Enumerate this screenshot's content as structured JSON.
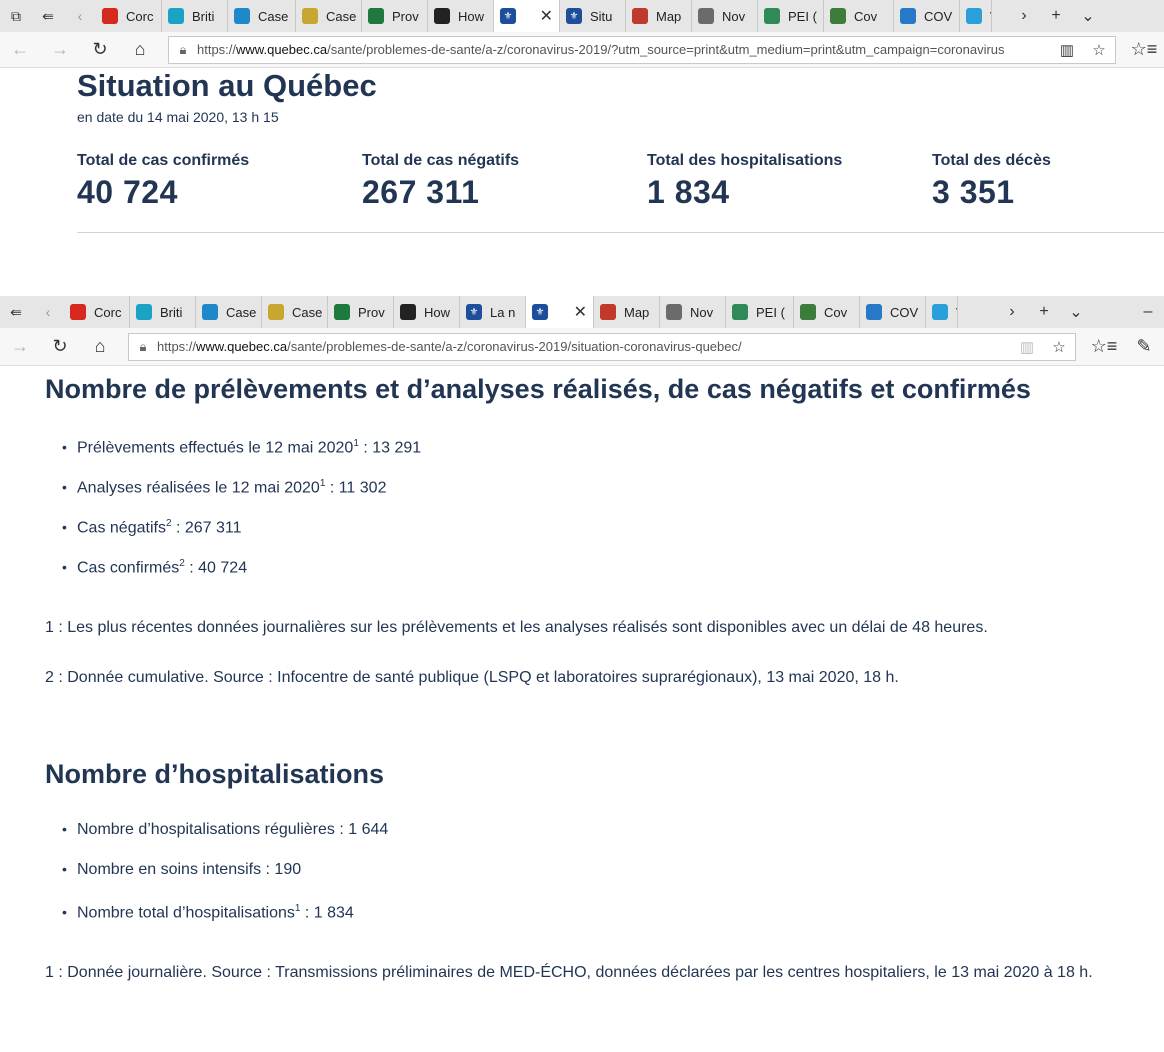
{
  "browser1": {
    "tabs": [
      {
        "label": "Corc",
        "color": "#d6281e",
        "icon": "maple-leaf-icon"
      },
      {
        "label": "Briti",
        "color": "#1ba3c6",
        "icon": "bc-icon"
      },
      {
        "label": "Case",
        "color": "#1e88c8",
        "icon": "alberta-icon"
      },
      {
        "label": "Case",
        "color": "#c8a630",
        "icon": "sask-icon"
      },
      {
        "label": "Prov",
        "color": "#1e7a3c",
        "icon": "manitoba-icon"
      },
      {
        "label": "How",
        "color": "#222222",
        "icon": "ontario-icon"
      },
      {
        "label": "",
        "color": "#1d4e9b",
        "icon": "quebec-fleur-icon",
        "active": true
      },
      {
        "label": "Situ",
        "color": "#1d4e9b",
        "icon": "quebec-fleur-icon"
      },
      {
        "label": "Map",
        "color": "#c0392b",
        "icon": "nb-icon"
      },
      {
        "label": "Nov",
        "color": "#6b6b6b",
        "icon": "ns-icon"
      },
      {
        "label": "PEI (",
        "color": "#2e8b57",
        "icon": "pei-icon"
      },
      {
        "label": "Cov",
        "color": "#3c7d3c",
        "icon": "nl-icon"
      },
      {
        "label": "COV",
        "color": "#2878c8",
        "icon": "yukon-icon"
      },
      {
        "label": "V",
        "color": "#2ba0d8",
        "icon": "nwt-icon"
      }
    ],
    "url_prefix": "https://",
    "url_host": "www.quebec.ca",
    "url_path": "/sante/problemes-de-sante/a-z/coronavirus-2019/?utm_source=print&utm_medium=print&utm_campaign=coronavirus"
  },
  "page1": {
    "title": "Situation au Québec",
    "date": "en date du 14 mai 2020, 13 h 15",
    "stats": [
      {
        "label": "Total de cas confirmés",
        "value": "40 724"
      },
      {
        "label": "Total de cas négatifs",
        "value": "267 311"
      },
      {
        "label": "Total des hospitalisations",
        "value": "1 834"
      },
      {
        "label": "Total des décès",
        "value": "3 351"
      }
    ]
  },
  "browser2": {
    "tabs": [
      {
        "label": "Corc",
        "color": "#d6281e",
        "icon": "maple-leaf-icon"
      },
      {
        "label": "Briti",
        "color": "#1ba3c6",
        "icon": "bc-icon"
      },
      {
        "label": "Case",
        "color": "#1e88c8",
        "icon": "alberta-icon"
      },
      {
        "label": "Case",
        "color": "#c8a630",
        "icon": "sask-icon"
      },
      {
        "label": "Prov",
        "color": "#1e7a3c",
        "icon": "manitoba-icon"
      },
      {
        "label": "How",
        "color": "#222222",
        "icon": "ontario-icon"
      },
      {
        "label": "La n",
        "color": "#1d4e9b",
        "icon": "quebec-fleur-icon"
      },
      {
        "label": "",
        "color": "#1d4e9b",
        "icon": "quebec-fleur-icon",
        "active": true
      },
      {
        "label": "Map",
        "color": "#c0392b",
        "icon": "nb-icon"
      },
      {
        "label": "Nov",
        "color": "#6b6b6b",
        "icon": "ns-icon"
      },
      {
        "label": "PEI (",
        "color": "#2e8b57",
        "icon": "pei-icon"
      },
      {
        "label": "Cov",
        "color": "#3c7d3c",
        "icon": "nl-icon"
      },
      {
        "label": "COV",
        "color": "#2878c8",
        "icon": "yukon-icon"
      },
      {
        "label": "V",
        "color": "#2ba0d8",
        "icon": "nwt-icon"
      }
    ],
    "url_prefix": "https://",
    "url_host": "www.quebec.ca",
    "url_path": "/sante/problemes-de-sante/a-z/coronavirus-2019/situation-coronavirus-quebec/"
  },
  "page2": {
    "section1": {
      "heading": "Nombre de prélèvements et d’analyses réalisés, de cas négatifs et confirmés",
      "items": [
        {
          "text": "Prélèvements effectués le 12 mai 2020",
          "sup": "1",
          "value": " : 13 291"
        },
        {
          "text": "Analyses réalisées le 12 mai 2020",
          "sup": "1",
          "value": " : 11 302"
        },
        {
          "text": "Cas négatifs",
          "sup": "2",
          "value": " : 267 311"
        },
        {
          "text": "Cas confirmés",
          "sup": "2",
          "value": " : 40 724"
        }
      ],
      "note1": "1 : Les plus récentes données journalières sur les prélèvements et les analyses réalisés sont disponibles avec un délai de 48 heures.",
      "note2": "2 : Donnée cumulative. Source : Infocentre de santé publique (LSPQ et laboratoires suprarégionaux), 13 mai 2020, 18 h."
    },
    "section2": {
      "heading": "Nombre d’hospitalisations",
      "items": [
        {
          "text": "Nombre d’hospitalisations régulières : 1 644",
          "sup": "",
          "value": ""
        },
        {
          "text": "Nombre en soins intensifs : 190",
          "sup": "",
          "value": ""
        },
        {
          "text": "Nombre total d’hospitalisations",
          "sup": "1",
          "value": " : 1 834"
        }
      ],
      "note1": "1 : Donnée journalière. Source : Transmissions préliminaires de MED-ÉCHO, données déclarées par les centres hospitaliers, le 13 mai 2020 à 18 h."
    }
  }
}
